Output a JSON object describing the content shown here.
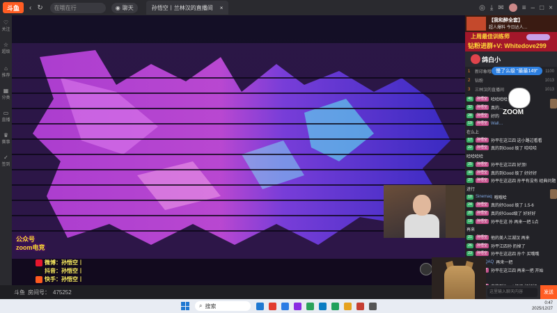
{
  "topbar": {
    "logo": "斗鱼",
    "search_placeholder": "在哦在行",
    "chat_label": "聊天",
    "tab_title": "孙悟空丨兰林汉的直播间"
  },
  "leftnav": [
    {
      "label": "关注",
      "icon": "heart-icon"
    },
    {
      "label": "超级",
      "icon": "star-icon"
    },
    {
      "label": "推荐",
      "icon": "home-icon"
    },
    {
      "label": "分类",
      "icon": "grid-icon"
    },
    {
      "label": "直播",
      "icon": "tv-icon"
    },
    {
      "label": "赛事",
      "icon": "trophy-icon"
    },
    {
      "label": "签到",
      "icon": "check-icon"
    }
  ],
  "video": {
    "promo_line1": "公众号",
    "promo_line2": "zoom电竞",
    "social": [
      {
        "label": "微博：孙悟空丨",
        "color": "#e6162d"
      },
      {
        "label": "抖音：孙悟空丨",
        "color": "#111111"
      },
      {
        "label": "快手：孙悟空丨",
        "color": "#ff5a1f"
      }
    ]
  },
  "bottombar": {
    "platform": "斗鱼",
    "room_label": "房间号：",
    "room_id": "475252"
  },
  "rightpanel": {
    "banner_title": "【我和醉全套】",
    "banner_sub": "超人爆料 今日达人…",
    "title_line1": "上周最佳训练师",
    "title_line2": "钻粉进群+V: Whitedove299",
    "rank_name": "鸽白小",
    "tip_text": "慢了么级 \"最最149\"",
    "rank": [
      {
        "no": "1",
        "name": "新印象哦哦哦",
        "val": "1100"
      },
      {
        "no": "2",
        "name": "钻粉",
        "val": "1013"
      },
      {
        "no": "3",
        "name": "三林汉的直播间",
        "val": "1013"
      }
    ],
    "chat": [
      {
        "lvl": "41",
        "fan": "孙悟空",
        "user": "",
        "msg": "哈哈哈哈"
      },
      {
        "lvl": "32",
        "fan": "孙悟空",
        "user": "",
        "msg": "真的…"
      },
      {
        "lvl": "28",
        "fan": "孙悟空",
        "user": "",
        "msg": "好的"
      },
      {
        "lvl": "19",
        "fan": "孙悟空",
        "user": "Wall…",
        "msg": ""
      },
      {
        "lvl": "",
        "fan": "",
        "user": "",
        "msg": "在么上"
      },
      {
        "lvl": "17",
        "fan": "孙悟空",
        "user": "",
        "msg": "孙平在这江四 这小路过看看"
      },
      {
        "lvl": "22",
        "fan": "孙悟空",
        "user": "",
        "msg": "真的到Good 级了 哈哈哈"
      },
      {
        "lvl": "",
        "fan": "",
        "user": "",
        "msg": "哈哈哈哈"
      },
      {
        "lvl": "25",
        "fan": "孙悟空",
        "user": "",
        "msg": "孙平在这江四 好顶!"
      },
      {
        "lvl": "30",
        "fan": "孙悟空",
        "user": "",
        "msg": "真的到Good 级了 好好好"
      },
      {
        "lvl": "27",
        "fan": "孙悟空",
        "user": "",
        "msg": "孙平在这这四 孙平有没有 经典问题 你可"
      },
      {
        "lvl": "",
        "fan": "",
        "user": "",
        "msg": "进行"
      },
      {
        "lvl": "10",
        "fan": "",
        "user": "Sinemaq",
        "msg": "哦哦哈"
      },
      {
        "lvl": "24",
        "fan": "孙悟空",
        "user": "",
        "msg": "真的好Good 级了 1.5-6"
      },
      {
        "lvl": "20",
        "fan": "孙悟空",
        "user": "",
        "msg": "真的好Good级了 好好好"
      },
      {
        "lvl": "18",
        "fan": "孙悟空",
        "user": "",
        "msg": "孙平在这 孙 再来一把 1点"
      },
      {
        "lvl": "",
        "fan": "",
        "user": "",
        "msg": "再来"
      },
      {
        "lvl": "21",
        "fan": "孙悟空",
        "user": "",
        "msg": "他的美人江湖汉 再来"
      },
      {
        "lvl": "26",
        "fan": "孙悟空",
        "user": "",
        "msg": "孙平江四孙 扔掉了"
      },
      {
        "lvl": "23",
        "fan": "孙悟空",
        "user": "",
        "msg": "孙平在这这四 孙个 买哦哦"
      },
      {
        "lvl": "16",
        "fan": "",
        "user": "HLWQAQ",
        "msg": "再来一把"
      },
      {
        "lvl": "29",
        "fan": "孙悟空",
        "user": "",
        "msg": "孙平在这江四 再来一把 开始"
      },
      {
        "lvl": "",
        "fan": "",
        "user": "",
        "msg": "won"
      },
      {
        "lvl": "31",
        "fan": "孙悟空",
        "user": "",
        "msg": "真的到Good 级了 好好好"
      },
      {
        "lvl": "15",
        "fan": "孙悟空",
        "user": "",
        "msg": "孙平江四 孙 文艺礼"
      }
    ],
    "input_placeholder": "这里输入聊天内容",
    "send_label": "发送"
  },
  "taskbar": {
    "search_label": "搜索",
    "time": "0:47",
    "date": "2025/12/27",
    "icons": [
      "#1f78d1",
      "#e23b2e",
      "#2b7be4",
      "#8a2be2",
      "#2aa25a",
      "#0a7cc2",
      "#1fa15c",
      "#e6a21f",
      "#c63f33",
      "#555555"
    ]
  }
}
